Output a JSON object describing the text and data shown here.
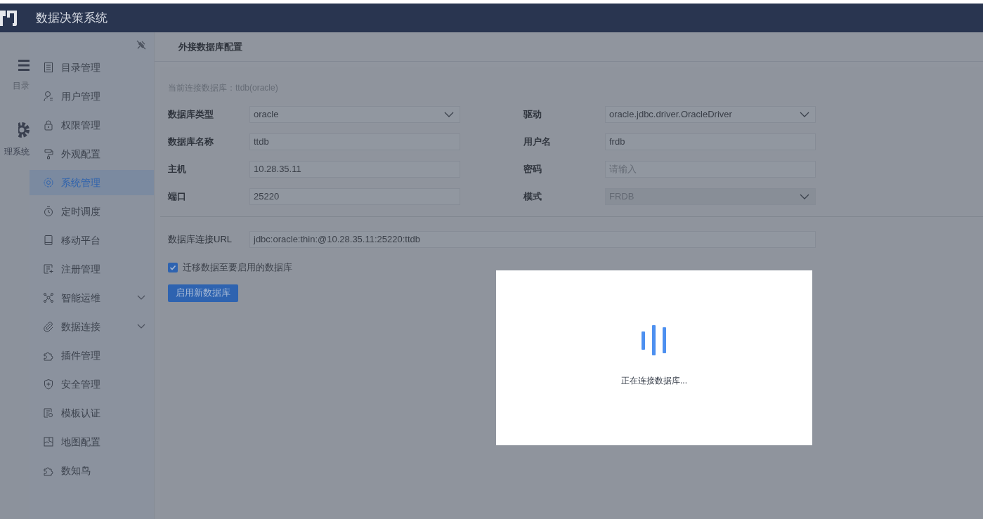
{
  "header": {
    "title": "数据决策系统"
  },
  "rail": [
    {
      "label": "目录"
    },
    {
      "label": "理系统"
    }
  ],
  "sidebar": {
    "items": [
      {
        "label": "目录管理",
        "selected": false,
        "has_submenu": false
      },
      {
        "label": "用户管理",
        "selected": false,
        "has_submenu": false
      },
      {
        "label": "权限管理",
        "selected": false,
        "has_submenu": false
      },
      {
        "label": "外观配置",
        "selected": false,
        "has_submenu": false
      },
      {
        "label": "系统管理",
        "selected": true,
        "has_submenu": false
      },
      {
        "label": "定时调度",
        "selected": false,
        "has_submenu": false
      },
      {
        "label": "移动平台",
        "selected": false,
        "has_submenu": false
      },
      {
        "label": "注册管理",
        "selected": false,
        "has_submenu": false
      },
      {
        "label": "智能运维",
        "selected": false,
        "has_submenu": true
      },
      {
        "label": "数据连接",
        "selected": false,
        "has_submenu": true
      },
      {
        "label": "插件管理",
        "selected": false,
        "has_submenu": false
      },
      {
        "label": "安全管理",
        "selected": false,
        "has_submenu": false
      },
      {
        "label": "模板认证",
        "selected": false,
        "has_submenu": false
      },
      {
        "label": "地图配置",
        "selected": false,
        "has_submenu": false
      },
      {
        "label": "数知鸟",
        "selected": false,
        "has_submenu": false
      }
    ]
  },
  "page": {
    "title": "外接数据库配置",
    "current": "当前连接数据库：ttdb(oracle)",
    "fields": [
      {
        "label": "数据库类型",
        "kind": "select",
        "value": "oracle",
        "disabled": false
      },
      {
        "label": "驱动",
        "kind": "select",
        "value": "oracle.jdbc.driver.OracleDriver",
        "disabled": false
      },
      {
        "label": "数据库名称",
        "kind": "input",
        "value": "ttdb",
        "disabled": false
      },
      {
        "label": "用户名",
        "kind": "input",
        "value": "frdb",
        "disabled": false
      },
      {
        "label": "主机",
        "kind": "input",
        "value": "10.28.35.11",
        "disabled": false
      },
      {
        "label": "密码",
        "kind": "input",
        "placeholder": "请输入",
        "disabled": false
      },
      {
        "label": "端口",
        "kind": "input",
        "value": "25220",
        "disabled": false
      },
      {
        "label": "模式",
        "kind": "select",
        "value": "FRDB",
        "disabled": true
      }
    ],
    "url": {
      "label": "数据库连接URL",
      "value": "jdbc:oracle:thin:@10.28.35.11:25220:ttdb"
    },
    "migrate": {
      "label": "迁移数据至要启用的数据库",
      "checked": true
    },
    "button": "启用新数据库"
  },
  "loading": {
    "message": "正在连接数据库..."
  }
}
